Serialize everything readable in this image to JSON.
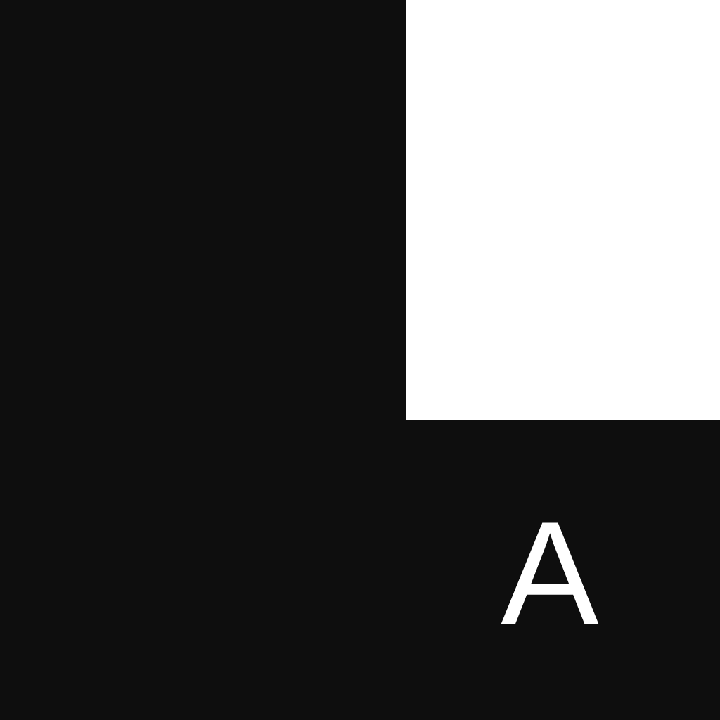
{
  "colors": {
    "background": "#0e0e0e",
    "block": "#ffffff",
    "text": "#ffffff"
  },
  "label": "A"
}
